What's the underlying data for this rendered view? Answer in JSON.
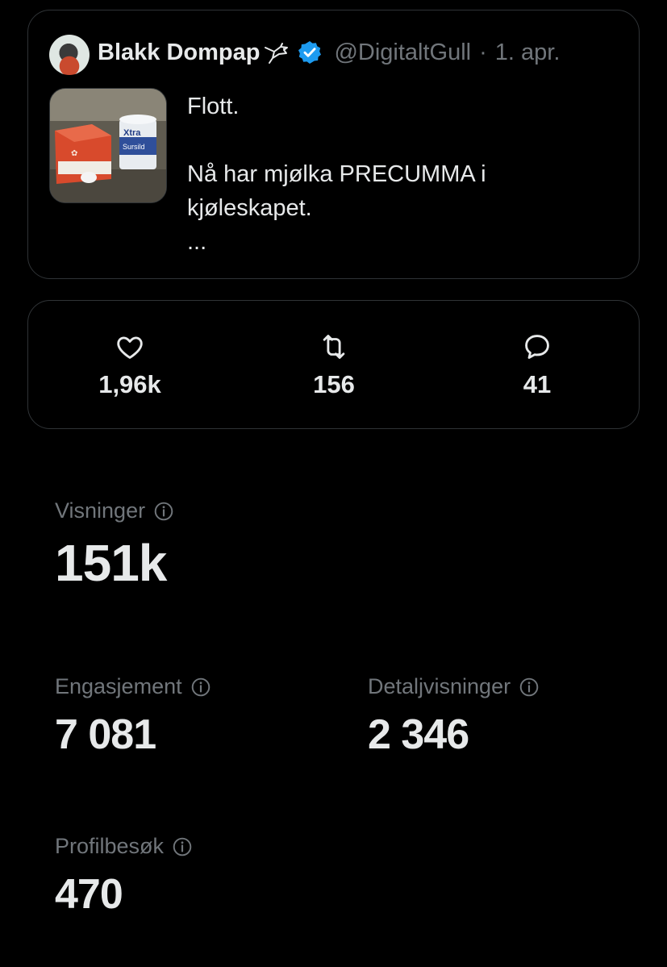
{
  "tweet": {
    "display_name": "Blakk Dompap",
    "handle": "@DigitaltGull",
    "separator": "·",
    "date": "1. apr.",
    "thumbnail_texts": [
      "Xtra",
      "Sursild"
    ],
    "text_lines": [
      "Flott.",
      "",
      "Nå har mjølka PRECUMMA i",
      "kjøleskapet.",
      "..."
    ]
  },
  "engagement": {
    "likes": "1,96k",
    "reposts": "156",
    "replies": "41"
  },
  "metrics": {
    "views_label": "Visninger",
    "views_value": "151k",
    "engagement_label": "Engasjement",
    "engagement_value": "7 081",
    "detail_label": "Detaljvisninger",
    "detail_value": "2 346",
    "profile_label": "Profilbesøk",
    "profile_value": "470"
  },
  "colors": {
    "background": "#000000",
    "text_primary": "#e7e9ea",
    "text_secondary": "#71767b",
    "border": "#2f3336",
    "verified": "#1d9bf0"
  }
}
